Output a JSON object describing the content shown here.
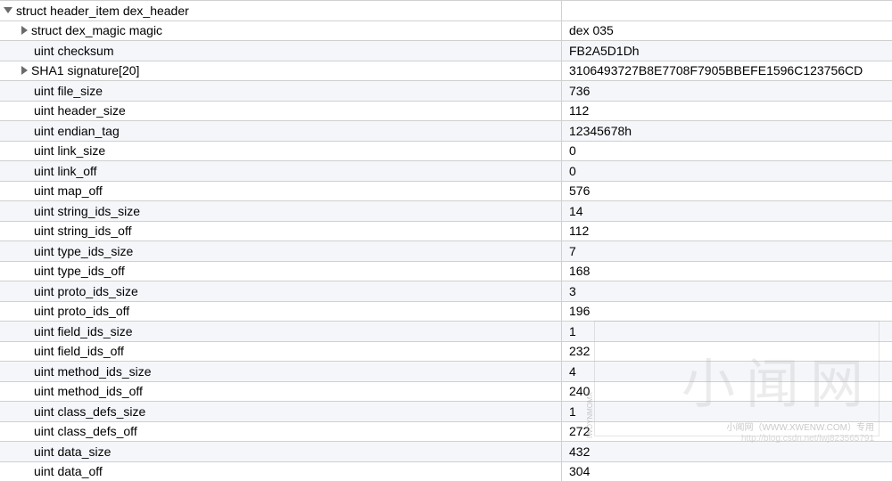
{
  "header": {
    "name": "struct header_item dex_header",
    "value": ""
  },
  "rows": [
    {
      "expandable": true,
      "name": "struct dex_magic magic",
      "value": "dex 035"
    },
    {
      "expandable": false,
      "name": "uint checksum",
      "value": "FB2A5D1Dh"
    },
    {
      "expandable": true,
      "name": "SHA1 signature[20]",
      "value": "3106493727B8E7708F7905BBEFE1596C123756CD"
    },
    {
      "expandable": false,
      "name": "uint file_size",
      "value": "736"
    },
    {
      "expandable": false,
      "name": "uint header_size",
      "value": "112"
    },
    {
      "expandable": false,
      "name": "uint endian_tag",
      "value": "12345678h"
    },
    {
      "expandable": false,
      "name": "uint link_size",
      "value": "0"
    },
    {
      "expandable": false,
      "name": "uint link_off",
      "value": "0"
    },
    {
      "expandable": false,
      "name": "uint map_off",
      "value": "576"
    },
    {
      "expandable": false,
      "name": "uint string_ids_size",
      "value": "14"
    },
    {
      "expandable": false,
      "name": "uint string_ids_off",
      "value": "112"
    },
    {
      "expandable": false,
      "name": "uint type_ids_size",
      "value": "7"
    },
    {
      "expandable": false,
      "name": "uint type_ids_off",
      "value": "168"
    },
    {
      "expandable": false,
      "name": "uint proto_ids_size",
      "value": "3"
    },
    {
      "expandable": false,
      "name": "uint proto_ids_off",
      "value": "196"
    },
    {
      "expandable": false,
      "name": "uint field_ids_size",
      "value": "1"
    },
    {
      "expandable": false,
      "name": "uint field_ids_off",
      "value": "232"
    },
    {
      "expandable": false,
      "name": "uint method_ids_size",
      "value": "4"
    },
    {
      "expandable": false,
      "name": "uint method_ids_off",
      "value": "240"
    },
    {
      "expandable": false,
      "name": "uint class_defs_size",
      "value": "1"
    },
    {
      "expandable": false,
      "name": "uint class_defs_off",
      "value": "272"
    },
    {
      "expandable": false,
      "name": "uint data_size",
      "value": "432"
    },
    {
      "expandable": false,
      "name": "uint data_off",
      "value": "304"
    }
  ],
  "watermark": {
    "main": "小闻网",
    "sub": "XWENW.COM",
    "line": "小闻网（WWW.XWENW.COM）专用",
    "url": "http://blog.csdn.net/lwj823565791",
    "vert": "IWOYNMOMX"
  }
}
